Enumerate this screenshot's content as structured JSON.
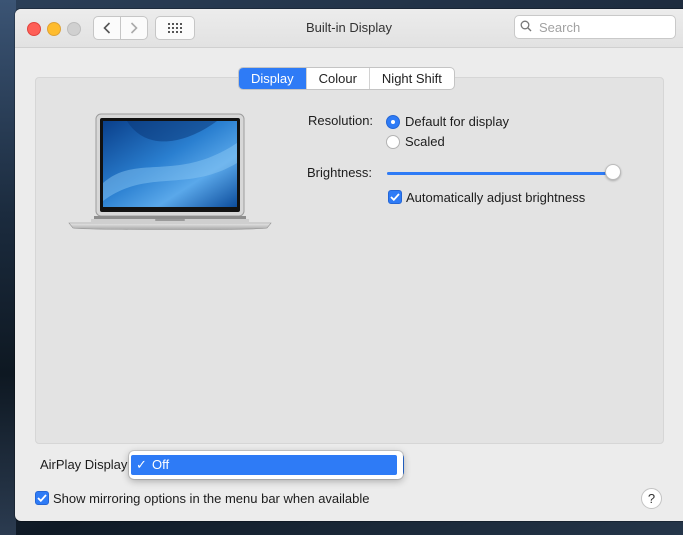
{
  "window": {
    "title": "Built-in Display"
  },
  "search": {
    "placeholder": "Search",
    "value": ""
  },
  "tabs": [
    {
      "label": "Display",
      "active": true
    },
    {
      "label": "Colour",
      "active": false
    },
    {
      "label": "Night Shift",
      "active": false
    }
  ],
  "resolution": {
    "label": "Resolution:",
    "options": [
      {
        "label": "Default for display",
        "selected": true
      },
      {
        "label": "Scaled",
        "selected": false
      }
    ]
  },
  "brightness": {
    "label": "Brightness:",
    "level": 1.0,
    "auto_adjust": {
      "label": "Automatically adjust brightness",
      "checked": true
    }
  },
  "airplay": {
    "label": "AirPlay Display",
    "menu": [
      {
        "label": "Off",
        "checked": true
      }
    ]
  },
  "mirroring": {
    "label": "Show mirroring options in the menu bar when available",
    "checked": true
  },
  "help": {
    "label": "?"
  },
  "colors": {
    "accent": "#2e7bf6",
    "window_bg": "#ececec",
    "panel_bg": "#e3e3e3"
  }
}
